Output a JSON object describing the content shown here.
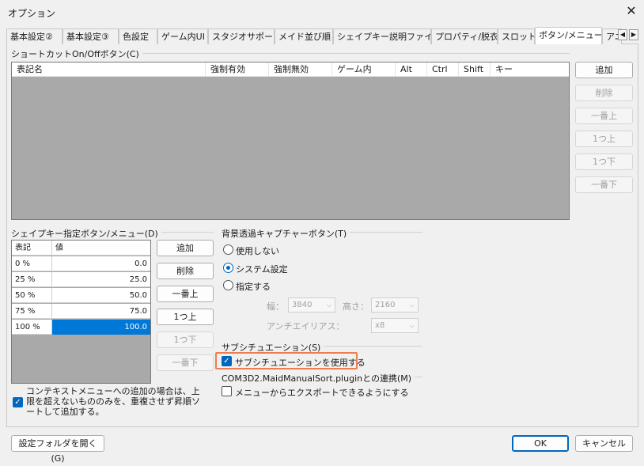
{
  "window": {
    "title": "オプション"
  },
  "tabs": [
    {
      "label": "基本設定②"
    },
    {
      "label": "基本設定③"
    },
    {
      "label": "色設定"
    },
    {
      "label": "ゲーム内UI"
    },
    {
      "label": "スタジオサポート"
    },
    {
      "label": "メイド並び順"
    },
    {
      "label": "シェイプキー説明ファイル"
    },
    {
      "label": "プロパティ/脱衣"
    },
    {
      "label": "スロット"
    },
    {
      "label": "ボタン/メニュー"
    },
    {
      "label": "アニ"
    }
  ],
  "shortcut_group": {
    "title": "ショートカットOn/Offボタン(C)",
    "columns": [
      "表記名",
      "強制有効",
      "強制無効",
      "ゲーム内",
      "Alt",
      "Ctrl",
      "Shift",
      "キー"
    ],
    "buttons": [
      "追加",
      "削除",
      "一番上",
      "1つ上",
      "1つ下",
      "一番下"
    ]
  },
  "shapekey_group": {
    "title": "シェイプキー指定ボタン/メニュー(D)",
    "columns": [
      "表記",
      "値"
    ],
    "rows": [
      {
        "label": "0 %",
        "value": "0.0"
      },
      {
        "label": "25 %",
        "value": "25.0"
      },
      {
        "label": "50 %",
        "value": "50.0"
      },
      {
        "label": "75 %",
        "value": "75.0"
      },
      {
        "label": "100 %",
        "value": "100.0"
      }
    ],
    "buttons": [
      "追加",
      "削除",
      "一番上",
      "1つ上",
      "1つ下",
      "一番下"
    ],
    "context_checkbox": "コンテキストメニューへの追加の場合は、上限を超えないもののみを、重複させず昇順ソートして追加する。"
  },
  "capture_group": {
    "title": "背景透過キャプチャーボタン(T)",
    "options": [
      "使用しない",
      "システム設定",
      "指定する"
    ],
    "width_label": "幅：",
    "width_value": "3840",
    "height_label": "高さ：",
    "height_value": "2160",
    "aa_label": "アンチエイリアス：",
    "aa_value": "x8"
  },
  "subsituation_group": {
    "title": "サブシチュエーション(S)",
    "checkbox": "サブシチュエーションを使用する"
  },
  "maidsort_group": {
    "title": "COM3D2.MaidManualSort.pluginとの連携(M)",
    "checkbox": "メニューからエクスポートできるようにする"
  },
  "footer": {
    "open_folder": "設定フォルダを開く(G)",
    "ok": "OK",
    "cancel": "キャンセル"
  },
  "colors": {
    "accent": "#0067c0",
    "selection": "#0078d7",
    "highlight_box": "#f07d50"
  }
}
